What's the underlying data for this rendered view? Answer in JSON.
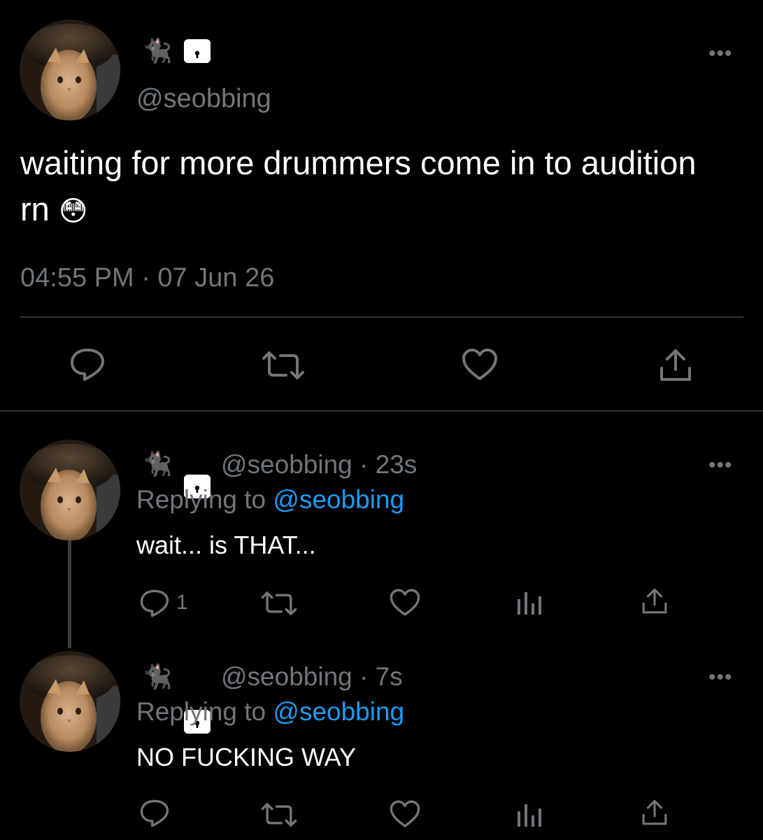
{
  "main_tweet": {
    "display_name_emoji": "🐈‍⬛",
    "handle": "@seobbing",
    "text": "waiting for more drummers come in to audition rn",
    "emoji": "😳",
    "timestamp": "04:55 PM · 07 Jun 26",
    "more_label": "•••"
  },
  "replies": [
    {
      "display_name_emoji": "🐈‍⬛",
      "handle": "@seobbing",
      "time": "· 23s",
      "replying_label": "Replying to",
      "replying_handle": "@seobbing",
      "text": "wait... is THAT...",
      "reply_count": "1",
      "more_label": "•••"
    },
    {
      "display_name_emoji": "🐈‍⬛",
      "handle": "@seobbing",
      "time": "· 7s",
      "replying_label": "Replying to",
      "replying_handle": "@seobbing",
      "text": "NO FUCKING WAY",
      "reply_count": "",
      "more_label": "•••"
    }
  ],
  "colors": {
    "background": "#000000",
    "muted": "#71767b",
    "link": "#1d9bf0",
    "divider": "#2f3336"
  }
}
